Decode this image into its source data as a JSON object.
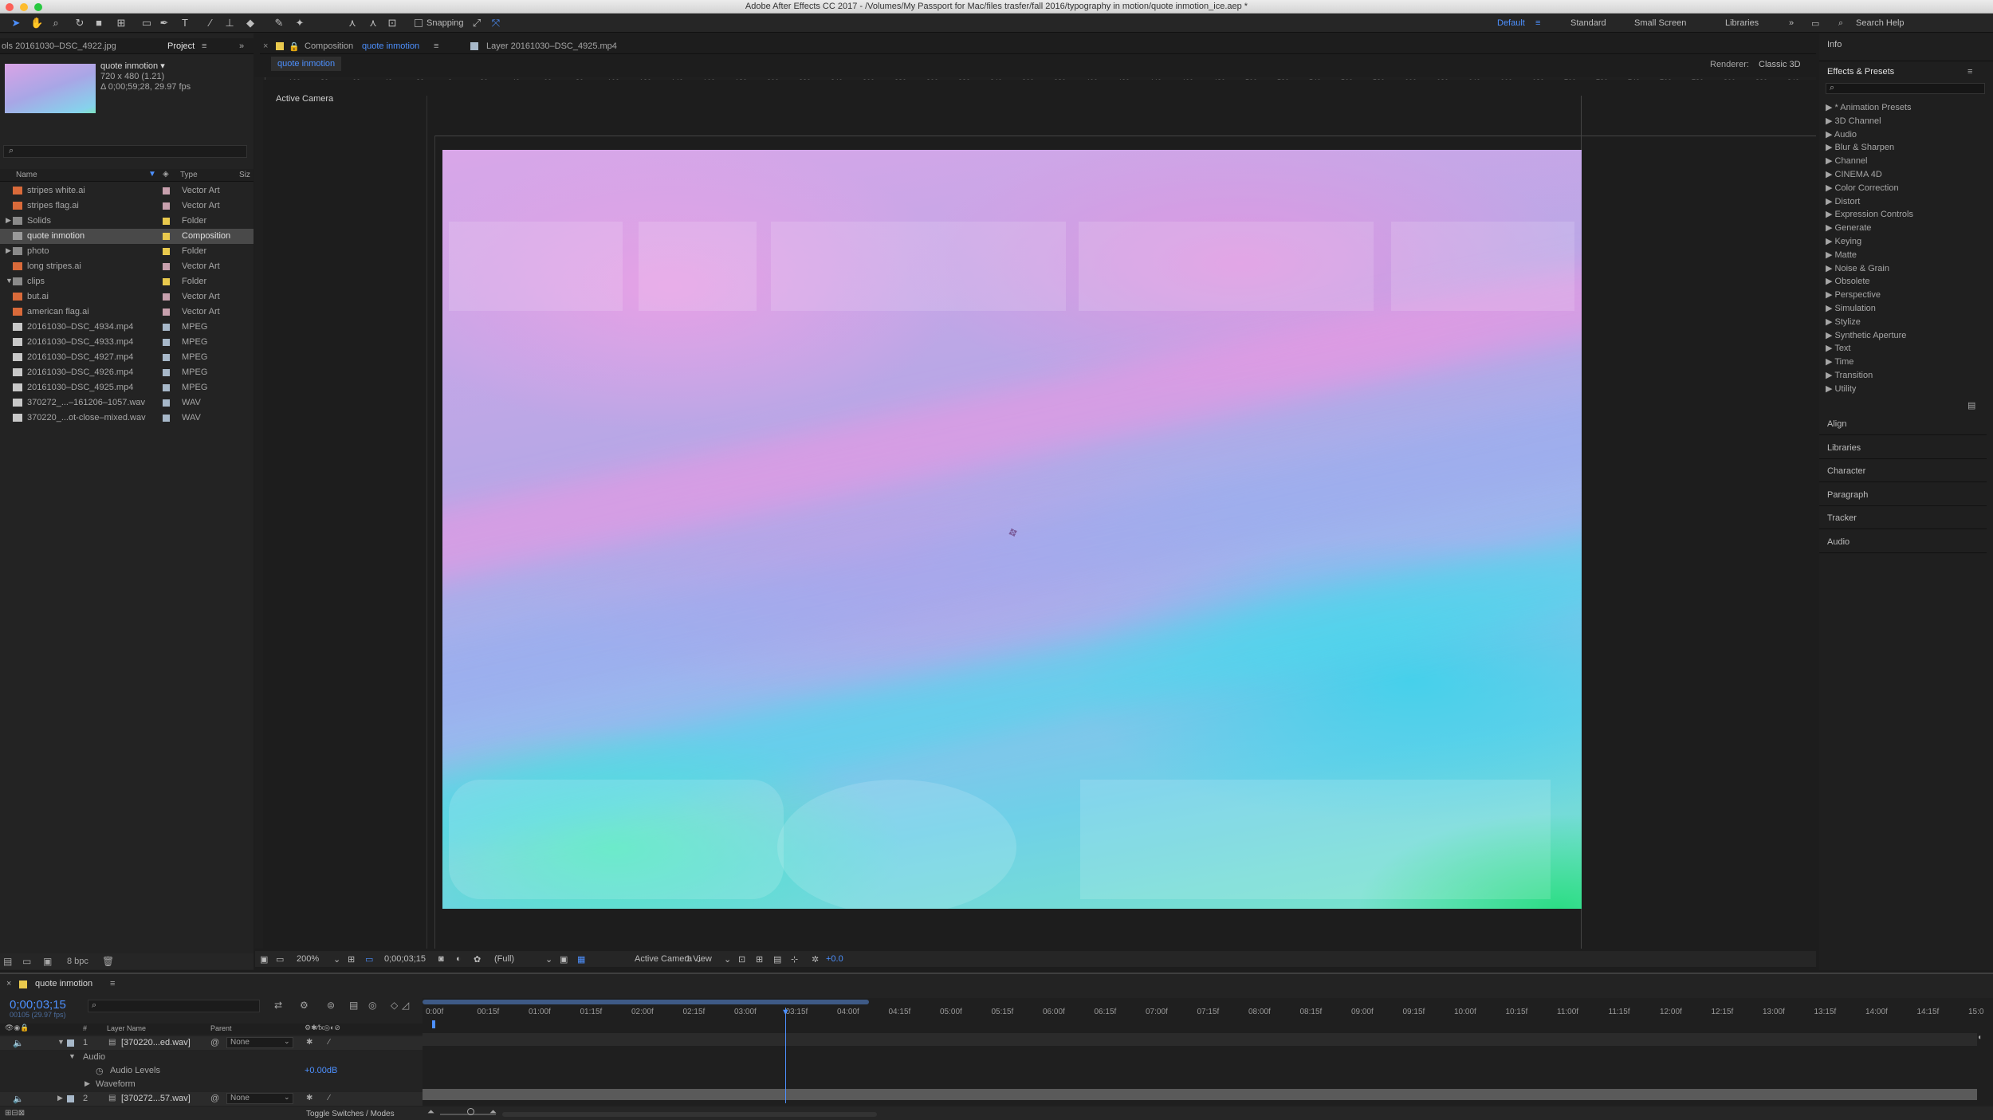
{
  "titlebar": {
    "title": "Adobe After Effects CC 2017 - /Volumes/My Passport for Mac/files trasfer/fall 2016/typography in motion/quote inmotion_ice.aep *"
  },
  "toolbar": {
    "tools": [
      "selection-icon",
      "hand-icon",
      "zoom-icon",
      "rotate-icon",
      "camera-icon",
      "pan-behind-icon",
      "rectangle-icon",
      "pen-icon",
      "type-icon",
      "brush-icon",
      "clone-stamp-icon",
      "eraser-icon",
      "roto-brush-icon",
      "puppet-pin-icon"
    ],
    "snapping_label": "Snapping",
    "workspaces": [
      "Default",
      "Standard",
      "Small Screen",
      "Libraries"
    ],
    "active_workspace": "Default",
    "search_help": "Search Help",
    "more": "»"
  },
  "project": {
    "left_tab": "ols 20161030–DSC_4922.jpg",
    "tab": "Project",
    "selected_name": "quote inmotion ▾",
    "selected_info1": "720 x 480 (1.21)",
    "selected_info2": "Δ 0;00;59;28, 29.97 fps",
    "col_name": "Name",
    "col_type": "Type",
    "col_size": "Siz",
    "items": [
      {
        "name": "stripes white.ai",
        "type": "Vector Art",
        "kind": "ai",
        "color": "#c7a0ad"
      },
      {
        "name": "stripes flag.ai",
        "type": "Vector Art",
        "kind": "ai",
        "color": "#c7a0ad"
      },
      {
        "name": "Solids",
        "type": "Folder",
        "kind": "folder",
        "color": "#e9c94d",
        "twirl": "▶"
      },
      {
        "name": "quote inmotion",
        "type": "Composition",
        "kind": "comp",
        "color": "#e9c94d",
        "selected": true
      },
      {
        "name": "photo",
        "type": "Folder",
        "kind": "folder",
        "color": "#e9c94d",
        "twirl": "▶"
      },
      {
        "name": "long stripes.ai",
        "type": "Vector Art",
        "kind": "ai",
        "color": "#c7a0ad"
      },
      {
        "name": "clips",
        "type": "Folder",
        "kind": "folder",
        "color": "#e9c94d",
        "twirl": "▼"
      },
      {
        "name": "but.ai",
        "type": "Vector Art",
        "kind": "ai",
        "color": "#c7a0ad"
      },
      {
        "name": "american flag.ai",
        "type": "Vector Art",
        "kind": "ai",
        "color": "#c7a0ad"
      },
      {
        "name": "20161030–DSC_4934.mp4",
        "type": "MPEG",
        "kind": "file",
        "color": "#a7b8c9"
      },
      {
        "name": "20161030–DSC_4933.mp4",
        "type": "MPEG",
        "kind": "file",
        "color": "#a7b8c9"
      },
      {
        "name": "20161030–DSC_4927.mp4",
        "type": "MPEG",
        "kind": "file",
        "color": "#a7b8c9"
      },
      {
        "name": "20161030–DSC_4926.mp4",
        "type": "MPEG",
        "kind": "file",
        "color": "#a7b8c9"
      },
      {
        "name": "20161030–DSC_4925.mp4",
        "type": "MPEG",
        "kind": "file",
        "color": "#a7b8c9"
      },
      {
        "name": "370272_...–161206–1057.wav",
        "type": "WAV",
        "kind": "file",
        "color": "#a7b8c9"
      },
      {
        "name": "370220_...ot-close–mixed.wav",
        "type": "WAV",
        "kind": "file",
        "color": "#a7b8c9"
      }
    ],
    "footer_bpc": "8 bpc"
  },
  "viewer": {
    "tab_comp_prefix": "Composition",
    "tab_comp_name": "quote inmotion",
    "tab_layer": "Layer 20161030–DSC_4925.mp4",
    "subtab": "quote inmotion",
    "renderer_label": "Renderer:",
    "renderer_value": "Classic 3D",
    "camera_label": "Active Camera",
    "ruler_labels": [
      "100",
      "80",
      "60",
      "40",
      "20",
      "0",
      "20",
      "40",
      "60",
      "80",
      "100",
      "120",
      "140",
      "160",
      "180",
      "200",
      "220",
      "240",
      "260",
      "280",
      "300",
      "320",
      "340",
      "360",
      "380",
      "400",
      "420",
      "440",
      "460",
      "480",
      "500",
      "520",
      "540",
      "560",
      "580",
      "600",
      "620",
      "640",
      "660",
      "680",
      "700",
      "720",
      "740",
      "760",
      "780",
      "800",
      "820",
      "840",
      "860"
    ],
    "footer": {
      "zoom": "200%",
      "timecode": "0;00;03;15",
      "resolution": "(Full)",
      "camera": "Active Camera",
      "views": "1 View",
      "exposure": "+0.0"
    }
  },
  "effects": {
    "info_tab": "Info",
    "title": "Effects & Presets",
    "categories": [
      "* Animation Presets",
      "3D Channel",
      "Audio",
      "Blur & Sharpen",
      "Channel",
      "CINEMA 4D",
      "Color Correction",
      "Distort",
      "Expression Controls",
      "Generate",
      "Keying",
      "Matte",
      "Noise & Grain",
      "Obsolete",
      "Perspective",
      "Simulation",
      "Stylize",
      "Synthetic Aperture",
      "Text",
      "Time",
      "Transition",
      "Utility"
    ],
    "panels": [
      "Align",
      "Libraries",
      "Character",
      "Paragraph",
      "Tracker",
      "Audio"
    ]
  },
  "timeline": {
    "tab": "quote inmotion",
    "current_time": "0;00;03;15",
    "frame_info": "00105 (29.97 fps)",
    "col_layer": "Layer Name",
    "col_parent": "Parent",
    "col_num": "#",
    "layers": [
      {
        "num": "1",
        "name": "[370220...ed.wav]",
        "parent": "None"
      },
      {
        "num": "2",
        "name": "[370272...57.wav]",
        "parent": "None"
      }
    ],
    "audio_group": "Audio",
    "audio_levels": "Audio Levels",
    "audio_value": "+0.00dB",
    "waveform": "Waveform",
    "toggle": "Toggle Switches / Modes",
    "ticks": [
      "0:00f",
      "00:15f",
      "01:00f",
      "01:15f",
      "02:00f",
      "02:15f",
      "03:00f",
      "03:15f",
      "04:00f",
      "04:15f",
      "05:00f",
      "05:15f",
      "06:00f",
      "06:15f",
      "07:00f",
      "07:15f",
      "08:00f",
      "08:15f",
      "09:00f",
      "09:15f",
      "10:00f",
      "10:15f",
      "11:00f",
      "11:15f",
      "12:00f",
      "12:15f",
      "13:00f",
      "13:15f",
      "14:00f",
      "14:15f",
      "15:0"
    ],
    "playhead_fraction": 0.233
  }
}
